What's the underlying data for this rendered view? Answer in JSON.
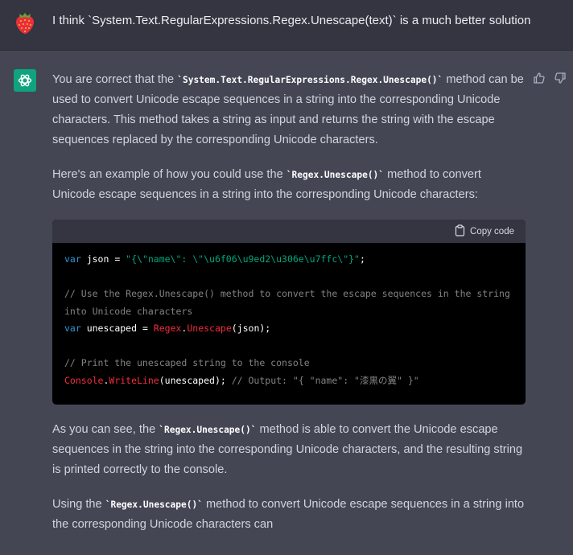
{
  "user_message": {
    "avatar": "strawberry-icon",
    "text": "I think `System.Text.RegularExpressions.Regex.Unescape(text)` is a much better solution"
  },
  "assistant": {
    "avatar": "openai-logo-icon",
    "feedback": [
      "thumbs-up-icon",
      "thumbs-down-icon"
    ],
    "p1": {
      "before": "You are correct that the ",
      "code": "`System.Text.RegularExpressions.Regex.Unescape()`",
      "after": " method can be used to convert Unicode escape sequences in a string into the corresponding Unicode characters. This method takes a string as input and returns the string with the escape sequences replaced by the corresponding Unicode characters."
    },
    "p2": {
      "before": "Here's an example of how you could use the ",
      "code": "`Regex.Unescape()`",
      "after": " method to convert Unicode escape sequences in a string into the corresponding Unicode characters:"
    },
    "code_block": {
      "copy_label": "Copy code",
      "l1_kw": "var",
      "l1_name": " json = ",
      "l1_str": "\"{\\\"name\\\": \\\"\\u6f06\\u9ed2\\u306e\\u7ffc\\\"}\"",
      "l1_end": ";",
      "l2_comment": "// Use the Regex.Unescape() method to convert the escape sequences in the string into Unicode characters",
      "l3_kw": "var",
      "l3_name": " unescaped = ",
      "l3_type": "Regex",
      "l3_dot": ".",
      "l3_method": "Unescape",
      "l3_end": "(json);",
      "l4_comment": "// Print the unescaped string to the console",
      "l5_type": "Console",
      "l5_dot": ".",
      "l5_method": "WriteLine",
      "l5_args": "(unescaped); ",
      "l5_comment": "// Output: \"{ \"name\": \"漆黒の翼\" }\""
    },
    "p3": {
      "before": "As you can see, the ",
      "code": "`Regex.Unescape()`",
      "after": " method is able to convert the Unicode escape sequences in the string into the corresponding Unicode characters, and the resulting string is printed correctly to the console."
    },
    "p4": {
      "before": "Using the ",
      "code": "`Regex.Unescape()`",
      "after": " method to convert Unicode escape sequences in a string into the corresponding Unicode characters can"
    }
  }
}
